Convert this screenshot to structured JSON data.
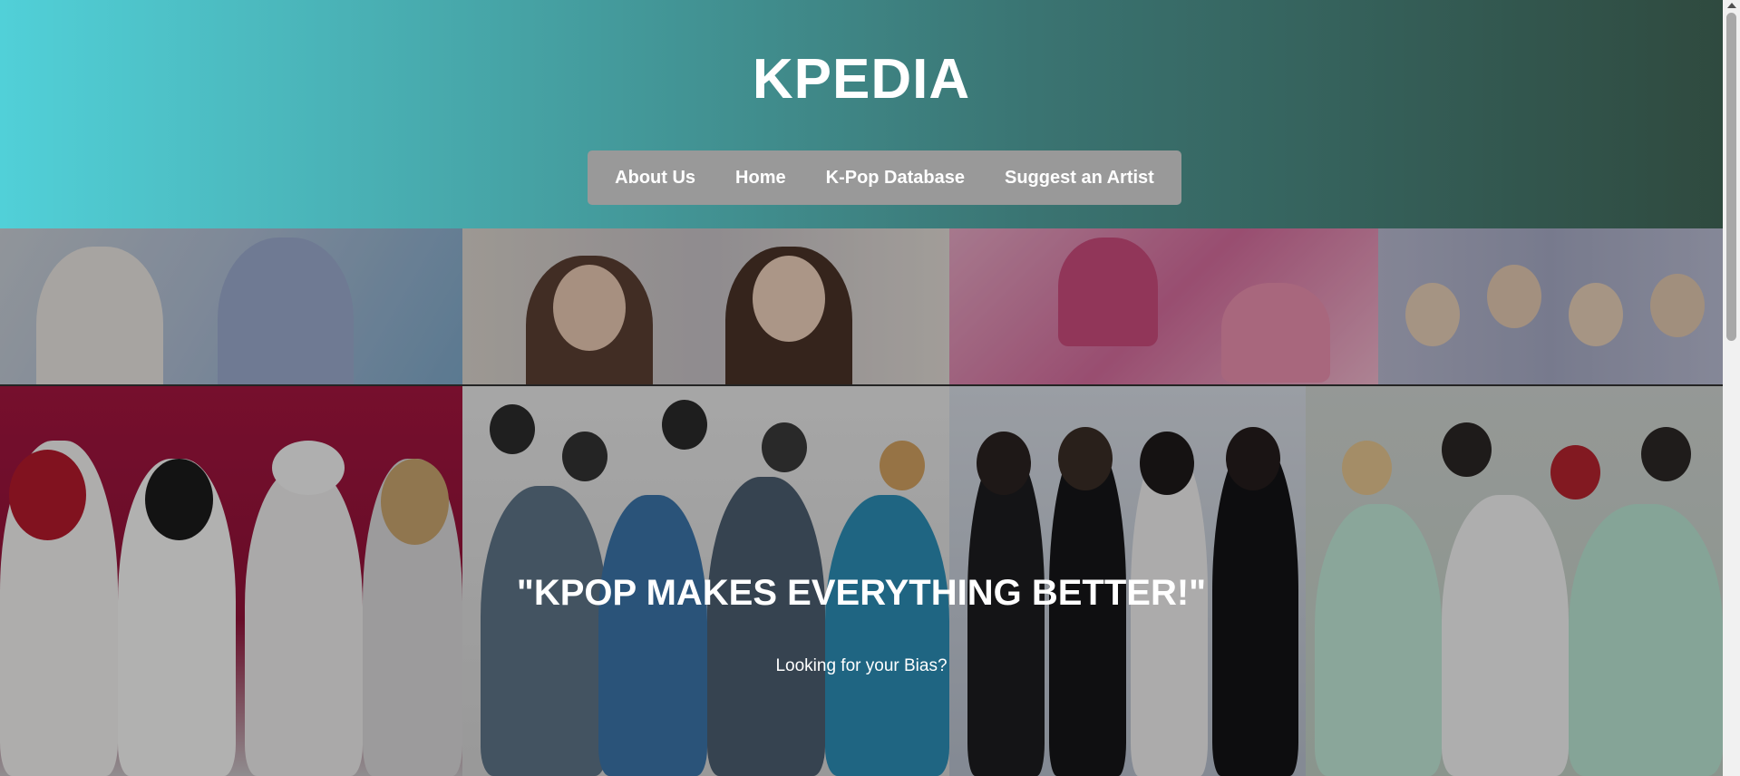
{
  "site": {
    "title": "KPEDIA"
  },
  "nav": {
    "items": [
      {
        "label": "About Us"
      },
      {
        "label": "Home"
      },
      {
        "label": "K-Pop Database"
      },
      {
        "label": "Suggest an Artist"
      }
    ]
  },
  "hero": {
    "quote": "\"KPOP MAKES EVERYTHING BETTER!\"",
    "subtitle": "Looking for your Bias?"
  },
  "colors": {
    "header_gradient": [
      "#51d0d8",
      "#2f4a3f"
    ],
    "nav_bg": "#999999",
    "text": "#ffffff"
  }
}
